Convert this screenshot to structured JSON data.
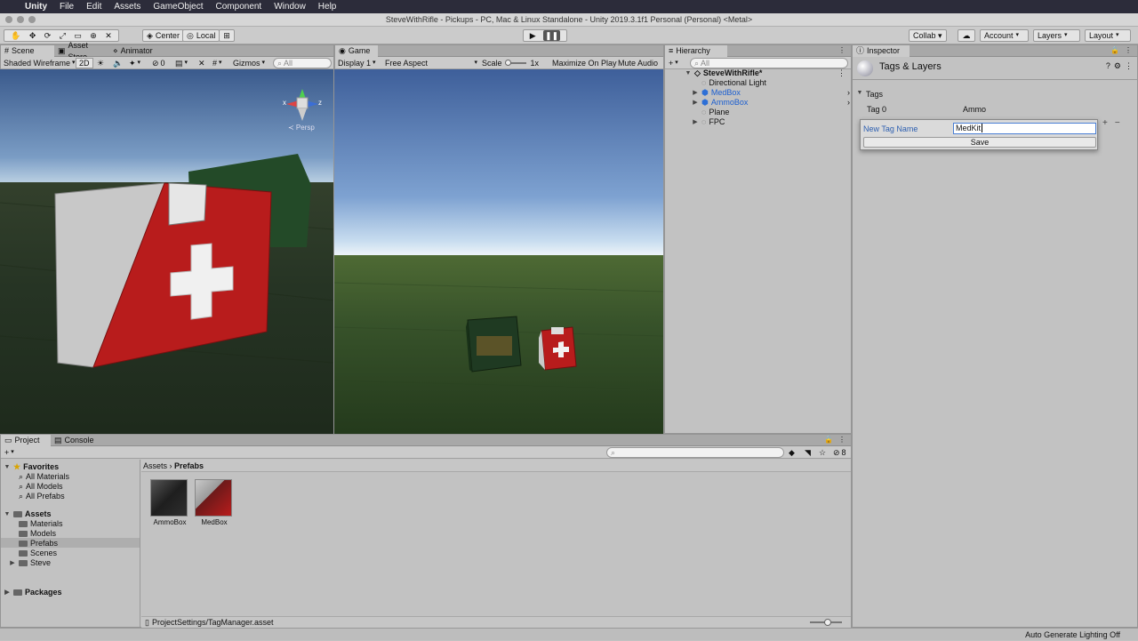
{
  "mac_menu": {
    "apple": "",
    "app": "Unity",
    "items": [
      "File",
      "Edit",
      "Assets",
      "GameObject",
      "Component",
      "Window",
      "Help"
    ]
  },
  "window_title": "SteveWithRifle - Pickups - PC, Mac & Linux Standalone - Unity 2019.3.1f1 Personal (Personal) <Metal>",
  "toolbar": {
    "center": "Center",
    "local": "Local",
    "collab": "Collab ▾",
    "account": "Account",
    "layers": "Layers",
    "layout": "Layout"
  },
  "scene": {
    "tabs": [
      "Scene",
      "Asset Store",
      "Animator"
    ],
    "shading": "Shaded Wireframe",
    "mode2d": "2D",
    "fx_count": "0",
    "gizmos": "Gizmos",
    "search_placeholder": "All",
    "persp": "≺ Persp",
    "axis_x": "x",
    "axis_z": "z"
  },
  "game": {
    "tab": "Game",
    "display": "Display 1",
    "aspect": "Free Aspect",
    "scale_label": "Scale",
    "scale_value": "1x",
    "maximize": "Maximize On Play",
    "mute": "Mute Audio"
  },
  "hierarchy": {
    "tab": "Hierarchy",
    "search_placeholder": "All",
    "scene": "SteveWithRifle*",
    "items": [
      {
        "label": "Directional Light",
        "prefab": false,
        "expandable": false
      },
      {
        "label": "MedBox",
        "prefab": true,
        "expandable": true
      },
      {
        "label": "AmmoBox",
        "prefab": true,
        "expandable": true
      },
      {
        "label": "Plane",
        "prefab": false,
        "expandable": false
      },
      {
        "label": "FPC",
        "prefab": false,
        "expandable": true
      }
    ]
  },
  "inspector": {
    "tab": "Inspector",
    "title": "Tags & Layers",
    "tags_header": "Tags",
    "tag0_label": "Tag 0",
    "tag0_value": "Ammo",
    "popup": {
      "label": "New Tag Name",
      "value": "MedKit",
      "save": "Save"
    }
  },
  "project": {
    "tabs": [
      "Project",
      "Console"
    ],
    "favorites": {
      "label": "Favorites",
      "items": [
        "All Materials",
        "All Models",
        "All Prefabs"
      ]
    },
    "assets": {
      "label": "Assets",
      "items": [
        "Materials",
        "Models",
        "Prefabs",
        "Scenes",
        "Steve"
      ]
    },
    "packages": "Packages",
    "breadcrumb": [
      "Assets",
      "Prefabs"
    ],
    "hidden_count": "8",
    "files": [
      {
        "name": "AmmoBox",
        "kind": "ammo"
      },
      {
        "name": "MedBox",
        "kind": "med"
      }
    ],
    "status_path": "ProjectSettings/TagManager.asset"
  },
  "statusbar": "Auto Generate Lighting Off",
  "colors": {
    "accent": "#2d6fd6",
    "prefab_blue": "#1c5fd0",
    "med_red": "#b81c1c"
  }
}
